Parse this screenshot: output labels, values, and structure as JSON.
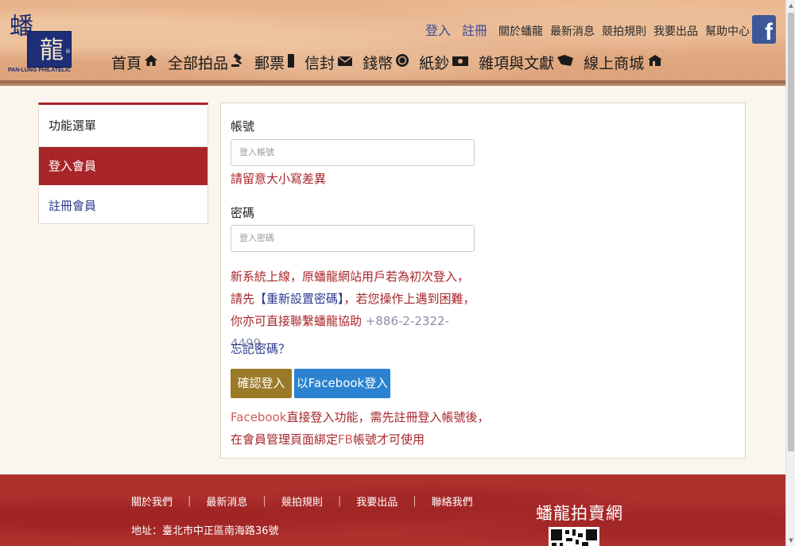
{
  "brand": {
    "logo_char_1": "蟠",
    "logo_char_2": "龍",
    "logo_reg": "®",
    "logo_subtitle": "PAN-LUNG PHILATELIC"
  },
  "header": {
    "auth_links": [
      "登入",
      "註冊"
    ],
    "util_links": [
      "關於蟠龍",
      "最新消息",
      "競拍規則",
      "我要出品",
      "幫助中心"
    ],
    "facebook_icon": "facebook-icon",
    "nav": [
      {
        "label": "首頁",
        "icon": "🏠",
        "icon_name": "home-icon"
      },
      {
        "label": "全部拍品",
        "icon": "⚖",
        "icon_name": "gavel-icon"
      },
      {
        "label": "郵票",
        "icon": "▮",
        "icon_name": "stamp-icon"
      },
      {
        "label": "信封",
        "icon": "✉",
        "icon_name": "envelope-icon"
      },
      {
        "label": "錢幣",
        "icon": "◉",
        "icon_name": "coin-icon"
      },
      {
        "label": "紙鈔",
        "icon": "▣",
        "icon_name": "banknote-icon"
      },
      {
        "label": "雜項與文獻",
        "icon": "❖",
        "icon_name": "book-icon"
      },
      {
        "label": "線上商城",
        "icon": "⌂",
        "icon_name": "shop-icon"
      }
    ]
  },
  "sidebar": {
    "title": "功能選單",
    "items": [
      {
        "label": "登入會員",
        "active": true
      },
      {
        "label": "註冊會員",
        "active": false
      }
    ]
  },
  "form": {
    "account_label": "帳號",
    "account_placeholder": "登入帳號",
    "account_hint": "請留意大小寫差異",
    "password_label": "密碼",
    "password_placeholder": "登入密碼",
    "notice_part1": "新系統上線，原蟠龍網站用戶若為初次登入，請先",
    "notice_link": "【重新設置密碼】",
    "notice_part2": "，若您操作上遇到困難，你亦可直接聯繫蟠龍協助",
    "notice_phone": "+886-2-2322-4499",
    "forgot_password": "忘記密碼？",
    "login_button": "確認登入",
    "facebook_button": "以Facebook登入",
    "fb_note_fb": "Facebook",
    "fb_note_part1": "直接登入功能，需先註冊登入帳號後，在會員管理頁面綁定",
    "fb_note_fb2": "FB",
    "fb_note_part2": "帳號才可使用"
  },
  "footer": {
    "links": [
      "關於我們",
      "最新消息",
      "競拍規則",
      "我要出品",
      "聯絡我們"
    ],
    "separator": "|",
    "address": "地址：臺北市中正區南海路36號",
    "brand": "蟠龍拍賣網"
  },
  "colors": {
    "accent_red": "#a8262a",
    "link_blue": "#2c3a8c",
    "login_gold": "#9b7a27",
    "facebook_blue": "#2a82d1"
  }
}
